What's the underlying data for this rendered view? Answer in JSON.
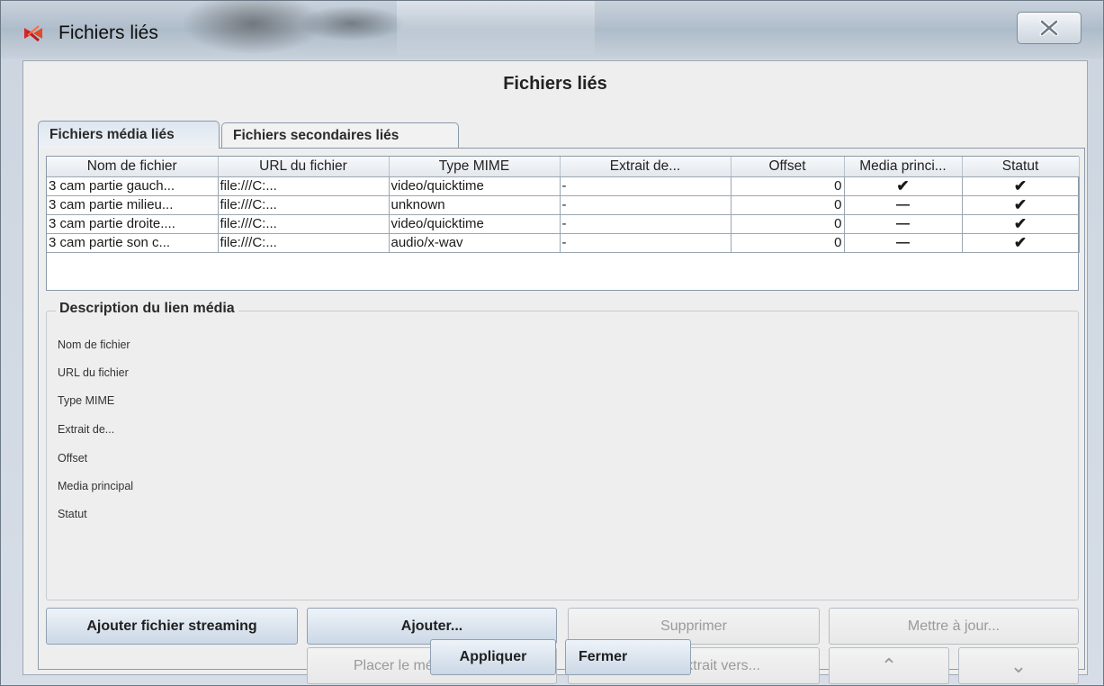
{
  "window": {
    "title": "Fichiers liés"
  },
  "dialog": {
    "heading": "Fichiers liés",
    "tabs": [
      {
        "label": "Fichiers média liés",
        "active": true
      },
      {
        "label": "Fichiers secondaires liés",
        "active": false
      }
    ]
  },
  "table": {
    "columns": [
      "Nom de fichier",
      "URL du fichier",
      "Type MIME",
      "Extrait de...",
      "Offset",
      "Media princi...",
      "Statut"
    ],
    "rows": [
      {
        "name": "3 cam partie gauch...",
        "url": "file:///C:...",
        "mime": "video/quicktime",
        "extract": "-",
        "offset": "0",
        "main_media": "check",
        "status": "check"
      },
      {
        "name": "3 cam partie milieu...",
        "url": "file:///C:...",
        "mime": "unknown",
        "extract": "-",
        "offset": "0",
        "main_media": "dash",
        "status": "check"
      },
      {
        "name": "3 cam partie droite....",
        "url": "file:///C:...",
        "mime": "video/quicktime",
        "extract": "-",
        "offset": "0",
        "main_media": "dash",
        "status": "check"
      },
      {
        "name": "3 cam partie son c...",
        "url": "file:///C:...",
        "mime": "audio/x-wav",
        "extract": "-",
        "offset": "0",
        "main_media": "dash",
        "status": "check"
      }
    ]
  },
  "description": {
    "title": "Description du lien média",
    "labels": [
      "Nom de fichier",
      "URL du fichier",
      "Type MIME",
      "Extrait de...",
      "Offset",
      "Media principal",
      "Statut"
    ]
  },
  "buttons": {
    "add_streaming": "Ajouter fichier streaming",
    "add": "Ajouter...",
    "remove": "Supprimer",
    "update": "Mettre à jour...",
    "set_main": "Placer le média principal",
    "set_extract": "Placer l'extrait vers...",
    "up": "⌃",
    "down": "⌄",
    "apply": "Appliquer",
    "close": "Fermer"
  },
  "icons": {
    "check": "✔",
    "dash": "—"
  }
}
